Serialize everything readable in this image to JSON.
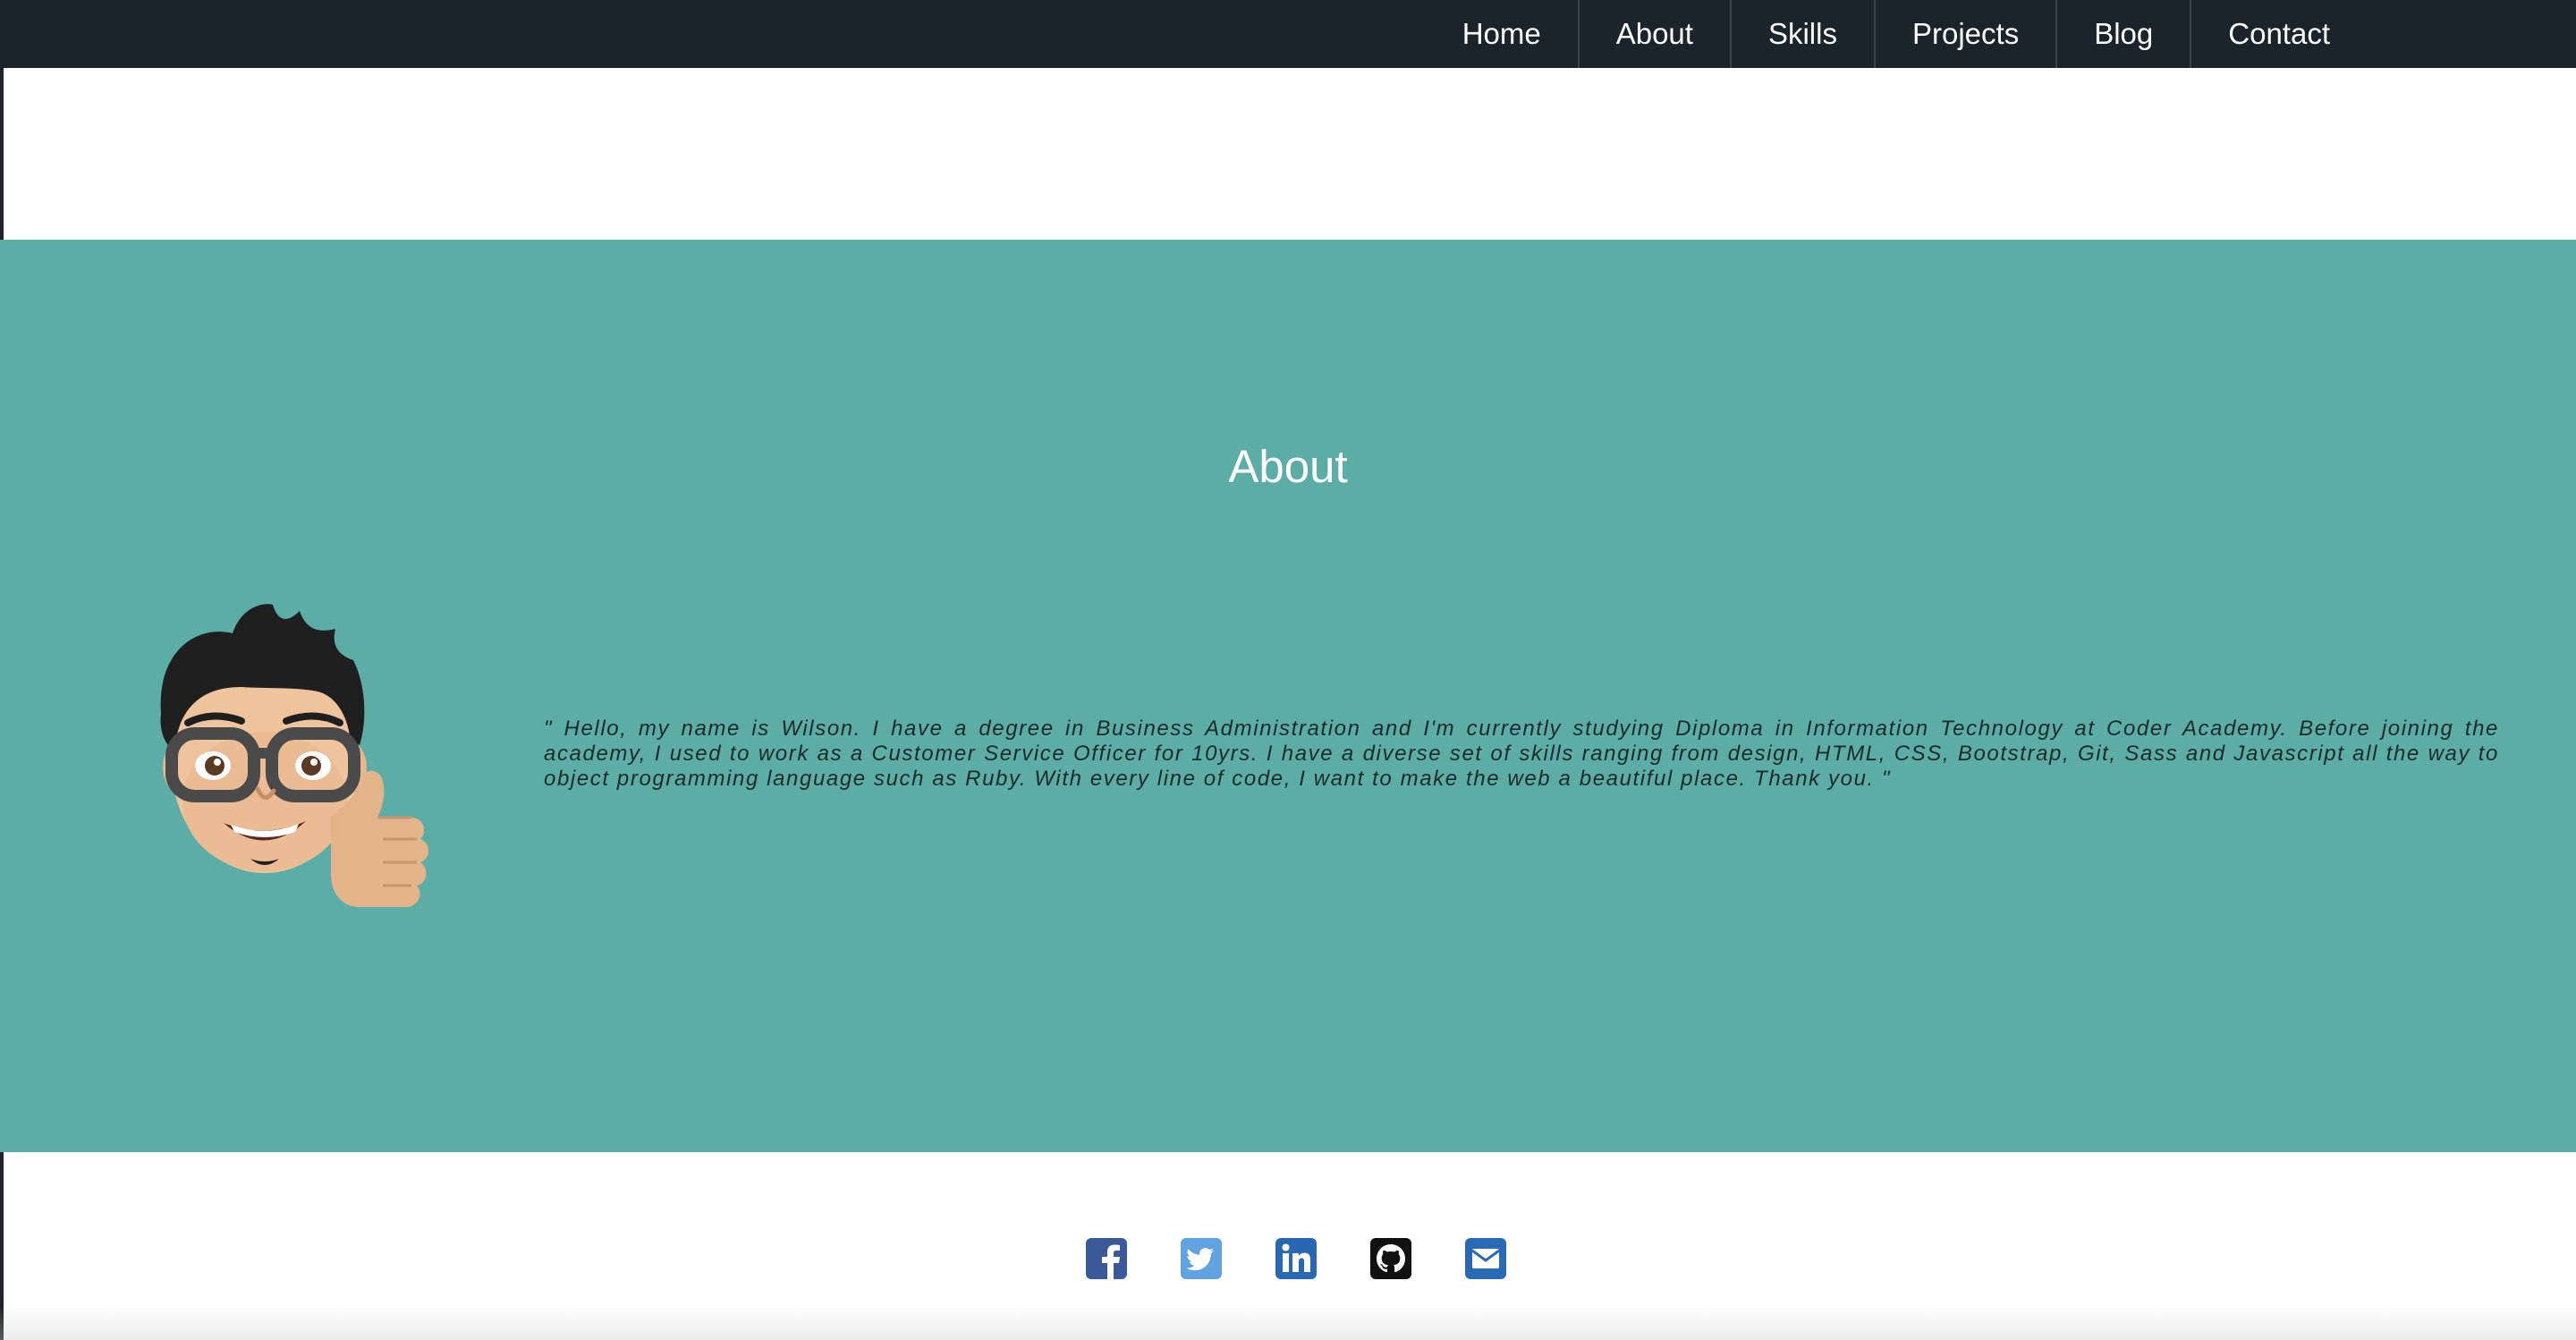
{
  "nav": {
    "items": [
      {
        "label": "Home"
      },
      {
        "label": "About"
      },
      {
        "label": "Skills"
      },
      {
        "label": "Projects"
      },
      {
        "label": "Blog"
      },
      {
        "label": "Contact"
      }
    ]
  },
  "about": {
    "title": "About",
    "text": "\" Hello, my name is Wilson. I have a degree in Business Administration and I'm currently studying Diploma in Information Technology at Coder Academy. Before joining the academy, I used to work as a Customer Service Officer for 10yrs. I have a diverse set of skills ranging from design, HTML, CSS, Bootstrap, Git, Sass and Javascript all the way to object programming language such as Ruby. With every line of code, I want to make the web a beautiful place. Thank you. \""
  },
  "social": {
    "icons": [
      "facebook-icon",
      "twitter-icon",
      "linkedin-icon",
      "github-icon",
      "email-icon"
    ],
    "colors": {
      "facebook": "#3b5998",
      "twitter": "#5fa4e0",
      "linkedin": "#2867b2",
      "github": "#111111",
      "email": "#2a6ab4"
    }
  },
  "colors": {
    "navbar": "#1b232b",
    "about_background": "#5dada7",
    "about_title": "#ffffff"
  }
}
